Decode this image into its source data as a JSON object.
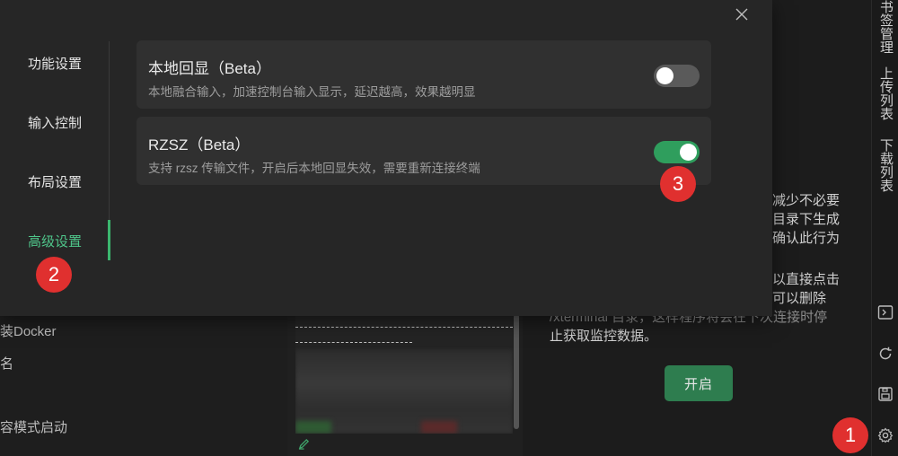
{
  "modal": {
    "nav": [
      {
        "label": "功能设置"
      },
      {
        "label": "输入控制"
      },
      {
        "label": "布局设置"
      },
      {
        "label": "高级设置",
        "active": true
      }
    ],
    "cards": [
      {
        "title": "本地回显（Beta）",
        "description": "本地融合输入，加速控制台输入显示，延迟越高，效果越明显",
        "enabled": false
      },
      {
        "title": "RZSZ（Beta）",
        "description": "支持 rzsz 传输文件，开启后本地回显失效，需要重新连接终端",
        "enabled": true
      }
    ],
    "close_icon": "close-icon"
  },
  "background": {
    "left_items": [
      "装Docker",
      "名",
      "容模式启动"
    ],
    "right_text": [
      "减少不必要",
      "目录下生成",
      "确认此行为",
      "以直接点击",
      "可以删除",
      "/xterminal 目录，这样程序将会在下次连接时停",
      "止获取监控数据。"
    ],
    "enable_button": "开启"
  },
  "sidebar": {
    "tabs": [
      "书签管理",
      "上传列表",
      "下载列表"
    ],
    "icons": [
      "terminal-icon",
      "refresh-icon",
      "save-icon",
      "settings-gear-icon"
    ]
  },
  "badges": [
    "1",
    "2",
    "3"
  ],
  "colors": {
    "accent": "#3bb66e",
    "toggle_on": "#2f9e5d",
    "badge": "#e0302f",
    "button": "#2e7d4f"
  }
}
